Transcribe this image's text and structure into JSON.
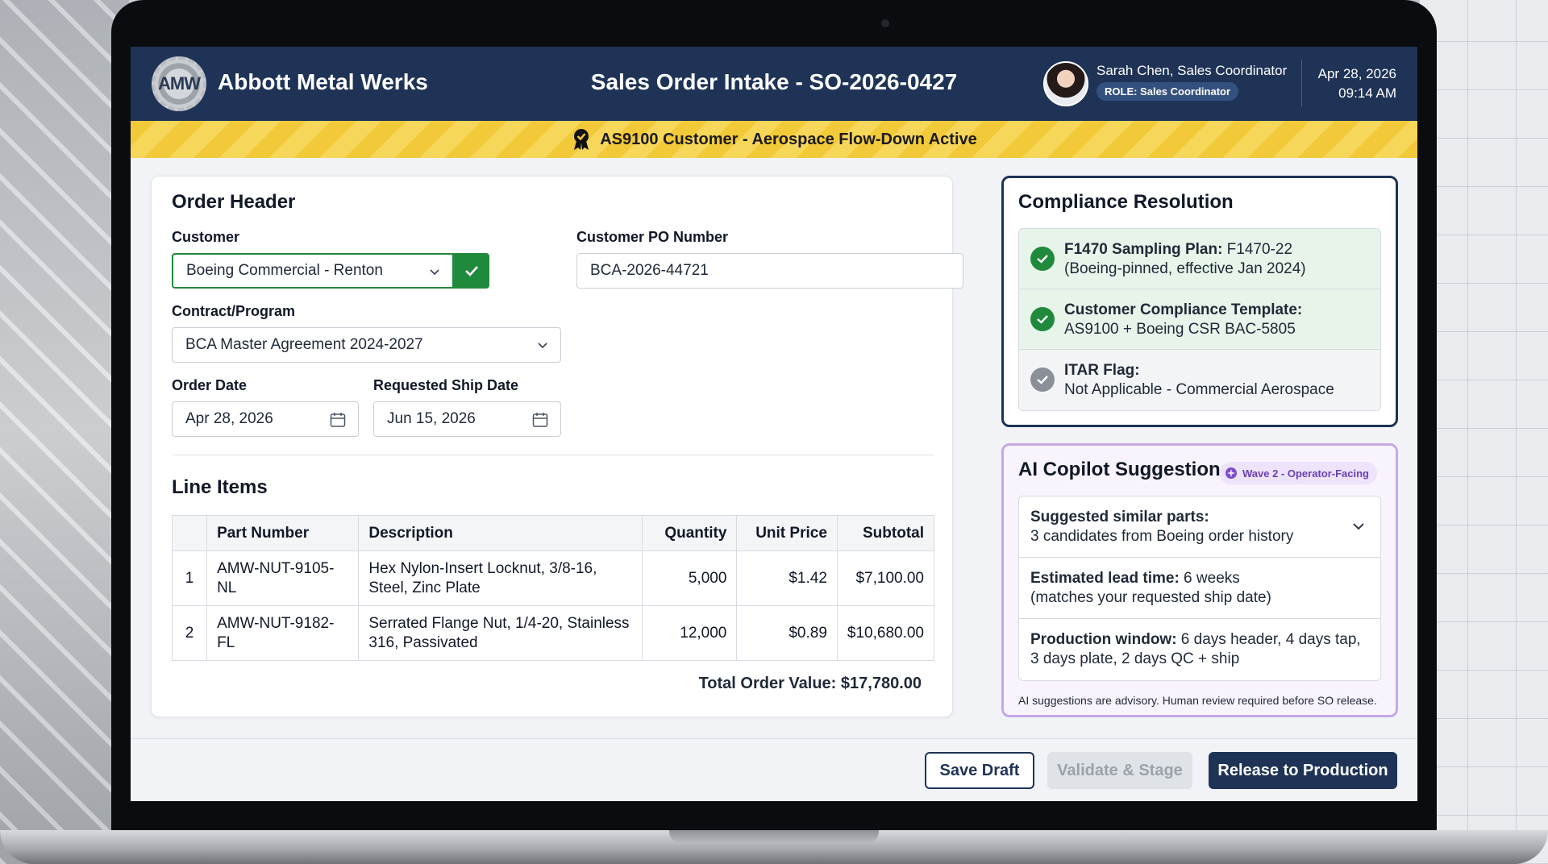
{
  "app": {
    "brand_logo_text": "AMW",
    "brand_name": "Abbott Metal Werks",
    "page_title": "Sales Order Intake - SO-2026-0427"
  },
  "user": {
    "name": "Sarah Chen, Sales Coordinator",
    "role_badge": "ROLE: Sales Coordinator",
    "date": "Apr 28, 2026",
    "time": "09:14 AM"
  },
  "banner": {
    "text": "AS9100 Customer - Aerospace Flow-Down Active",
    "icon": "award-ribbon-icon",
    "color": "#f2c938"
  },
  "order_header": {
    "title": "Order Header",
    "customer_label": "Customer",
    "customer_value": "Boeing Commercial - Renton",
    "customer_status": "validated",
    "po_label": "Customer PO Number",
    "po_value": "BCA-2026-44721",
    "contract_label": "Contract/Program",
    "contract_value": "BCA Master Agreement 2024-2027",
    "order_date_label": "Order Date",
    "order_date_value": "Apr 28, 2026",
    "ship_date_label": "Requested Ship Date",
    "ship_date_value": "Jun 15, 2026"
  },
  "line_items": {
    "title": "Line Items",
    "columns": [
      "",
      "Part Number",
      "Description",
      "Quantity",
      "Unit Price",
      "Subtotal"
    ],
    "rows": [
      {
        "idx": "1",
        "part": "AMW-NUT-9105-NL",
        "desc_1": "Hex Nylon-Insert Locknut, 3/8-16,",
        "desc_2": "Steel, Zinc Plate",
        "qty": "5,000",
        "price": "$1.42",
        "subtotal": "$7,100.00"
      },
      {
        "idx": "2",
        "part": "AMW-NUT-9182-FL",
        "desc_1": "Serrated Flange Nut, 1/4-20, Stainless",
        "desc_2": "316, Passivated",
        "qty": "12,000",
        "price": "$0.89",
        "subtotal": "$10,680.00"
      }
    ],
    "total": "Total Order Value: $17,780.00"
  },
  "compliance": {
    "title": "Compliance Resolution",
    "items": [
      {
        "label": "F1470 Sampling Plan:",
        "value": " F1470-22",
        "line2": "(Boeing-pinned, effective Jan 2024)",
        "status": "ok"
      },
      {
        "label": "Customer Compliance Template:",
        "value": "",
        "line2": "AS9100 + Boeing CSR BAC-5805",
        "status": "ok"
      },
      {
        "label": "ITAR Flag:",
        "value": "",
        "line2": "Not Applicable - Commercial Aerospace",
        "status": "na"
      }
    ]
  },
  "copilot": {
    "title": "AI Copilot Suggestions",
    "badge": "Wave 2 - Operator-Facing",
    "items": [
      {
        "label": "Suggested similar parts:",
        "value": "",
        "line2": "3 candidates from Boeing order history"
      },
      {
        "label": "Estimated lead time:",
        "value": " 6 weeks",
        "line2": "(matches your requested ship date)"
      },
      {
        "label": "Production window:",
        "value": " 6 days header, 4 days tap,",
        "line2": "3 days plate, 2 days QC + ship"
      }
    ],
    "disclaimer": "AI suggestions are advisory. Human review required before SO release."
  },
  "actions": {
    "save": "Save Draft",
    "validate": "Validate & Stage",
    "release": "Release to Production"
  },
  "colors": {
    "navy": "#1e3356",
    "success": "#1f8a3c",
    "ai_purple": "#c4a8e8"
  }
}
